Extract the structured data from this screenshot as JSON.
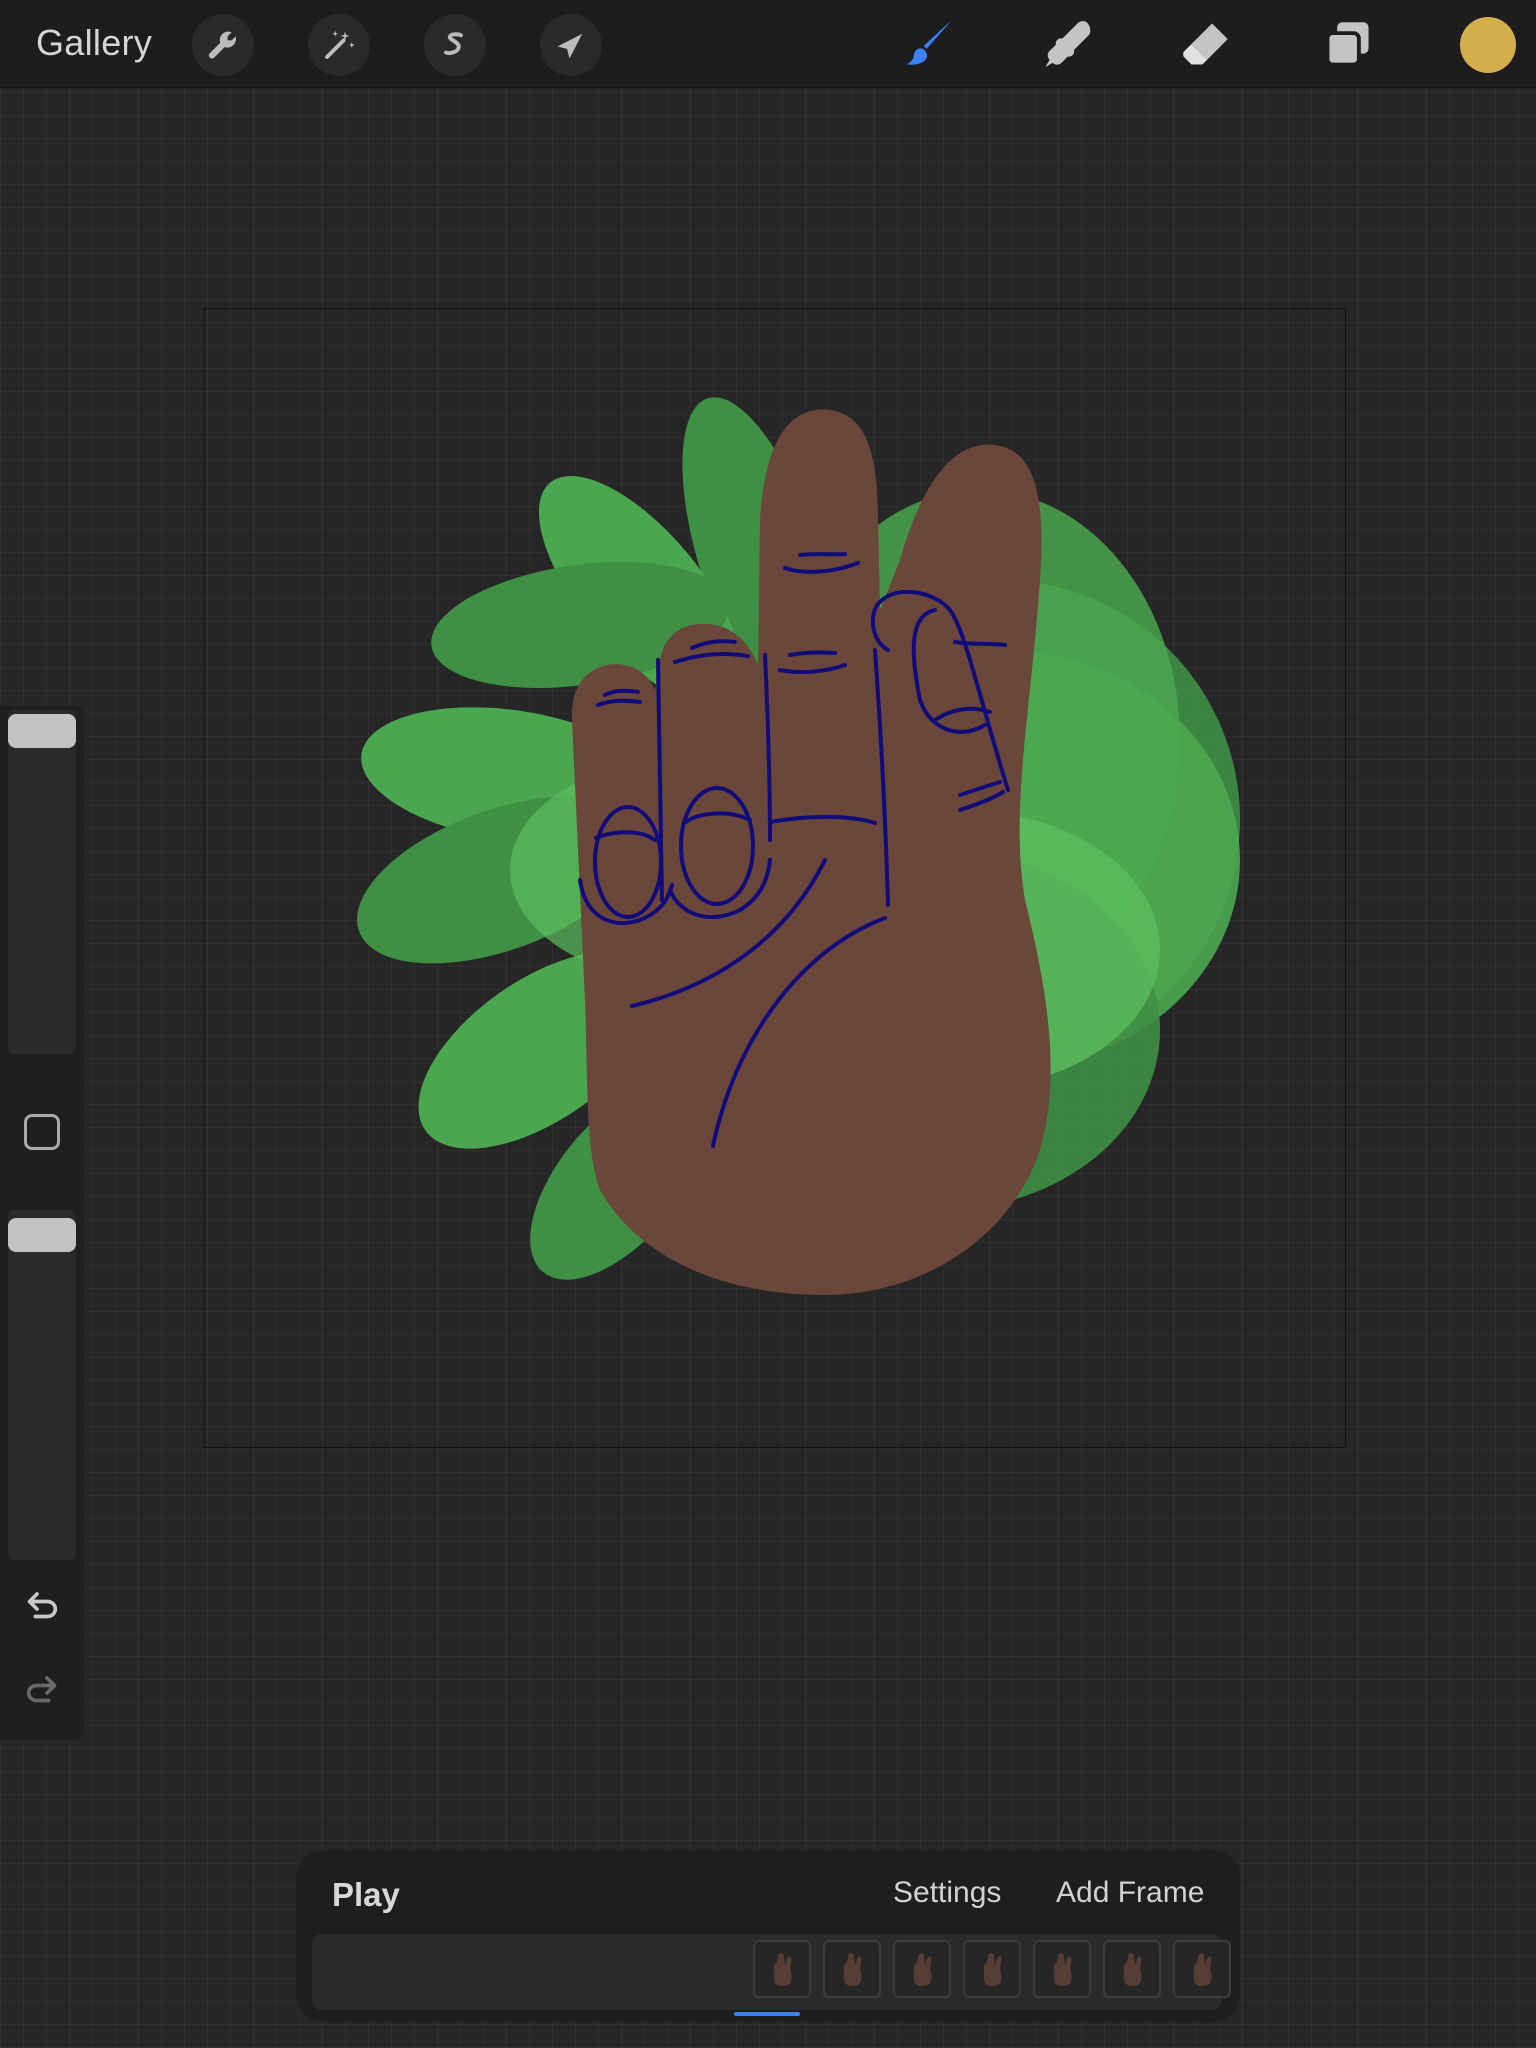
{
  "topbar": {
    "gallery_label": "Gallery",
    "left_tools": [
      {
        "name": "actions",
        "icon": "wrench-icon"
      },
      {
        "name": "adjustments",
        "icon": "magic-wand-icon"
      },
      {
        "name": "selection",
        "icon": "selection-s-icon"
      },
      {
        "name": "transform",
        "icon": "arrow-cursor-icon"
      }
    ],
    "right_tools": [
      {
        "name": "brush",
        "icon": "brush-icon",
        "active": true
      },
      {
        "name": "smudge",
        "icon": "smudge-icon",
        "active": false
      },
      {
        "name": "eraser",
        "icon": "eraser-icon",
        "active": false
      },
      {
        "name": "layers",
        "icon": "layers-icon",
        "active": false
      }
    ],
    "current_color": "#d4ae4a",
    "active_tool_color": "#3b82f6"
  },
  "sidebar": {
    "brush_size_level": 1.0,
    "opacity_level": 1.0,
    "icons": [
      "modifier-square-icon",
      "undo-icon",
      "redo-icon"
    ]
  },
  "artwork": {
    "skin_color": "#6a463b",
    "line_color": "#120c7a",
    "leaf_colors": [
      "#3f8f45",
      "#4aa64f",
      "#5bbd5c"
    ]
  },
  "animation": {
    "play_label": "Play",
    "settings_label": "Settings",
    "add_frame_label": "Add Frame",
    "frame_count": 7,
    "active_frame": 1,
    "accent": "#3b82f6"
  }
}
